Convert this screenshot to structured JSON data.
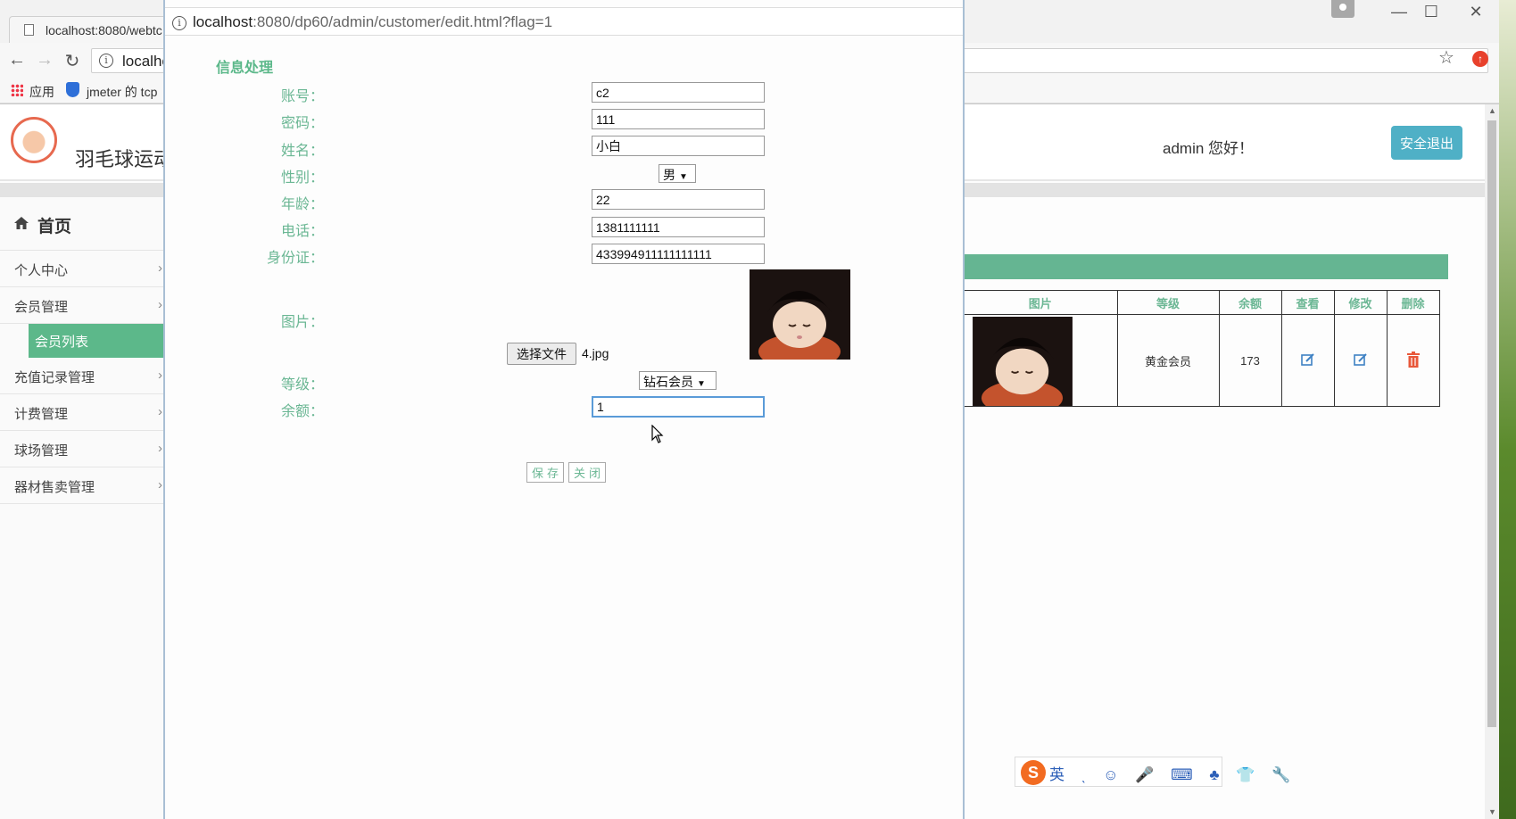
{
  "browser": {
    "tab_title": "localhost:8080/webtc",
    "address": "localhc",
    "bookmarks": [
      "应用",
      "jmeter 的 tcp"
    ],
    "window_controls": [
      "—",
      "☐",
      "✕"
    ]
  },
  "header": {
    "site_title": "羽毛球运动",
    "greeting": "admin 您好！",
    "logout_label": "安全退出"
  },
  "sidebar": {
    "home_label": "首页",
    "items": [
      {
        "label": "个人中心"
      },
      {
        "label": "会员管理"
      },
      {
        "label": "充值记录管理"
      },
      {
        "label": "计费管理"
      },
      {
        "label": "球场管理"
      },
      {
        "label": "器材售卖管理"
      }
    ],
    "active_sub": "会员列表"
  },
  "member_table": {
    "columns": [
      "图片",
      "等级",
      "余额",
      "查看",
      "修改",
      "删除"
    ],
    "rows": [
      {
        "level": "黄金会员",
        "balance": "173"
      }
    ]
  },
  "modal": {
    "url_host": "localhost",
    "url_rest": ":8080/dp60/admin/customer/edit.html?flag=1",
    "title": "信息处理",
    "fields": {
      "account": {
        "label": "账号：",
        "value": "c2"
      },
      "password": {
        "label": "密码：",
        "value": "111"
      },
      "name": {
        "label": "姓名：",
        "value": "小白"
      },
      "gender": {
        "label": "性别：",
        "value": "男"
      },
      "age": {
        "label": "年龄：",
        "value": "22"
      },
      "phone": {
        "label": "电话：",
        "value": "1381111111"
      },
      "id_card": {
        "label": "身份证：",
        "value": "433994911111111111"
      },
      "photo": {
        "label": "图片："
      },
      "level": {
        "label": "等级：",
        "value": "钻石会员"
      },
      "balance": {
        "label": "余额：",
        "value": "1"
      }
    },
    "file_button": "选择文件",
    "file_name": "4.jpg",
    "save_label": "保存",
    "close_label": "关闭"
  },
  "ime": {
    "logo": "S",
    "items": "英 ˎ ☺ 🎤 ⌨ ♣ 👕 🔧"
  },
  "colors": {
    "accent_green": "#5cb88a",
    "label_green": "#6bb794",
    "logout_blue": "#4fb0c6",
    "delete_red": "#e8583a"
  }
}
